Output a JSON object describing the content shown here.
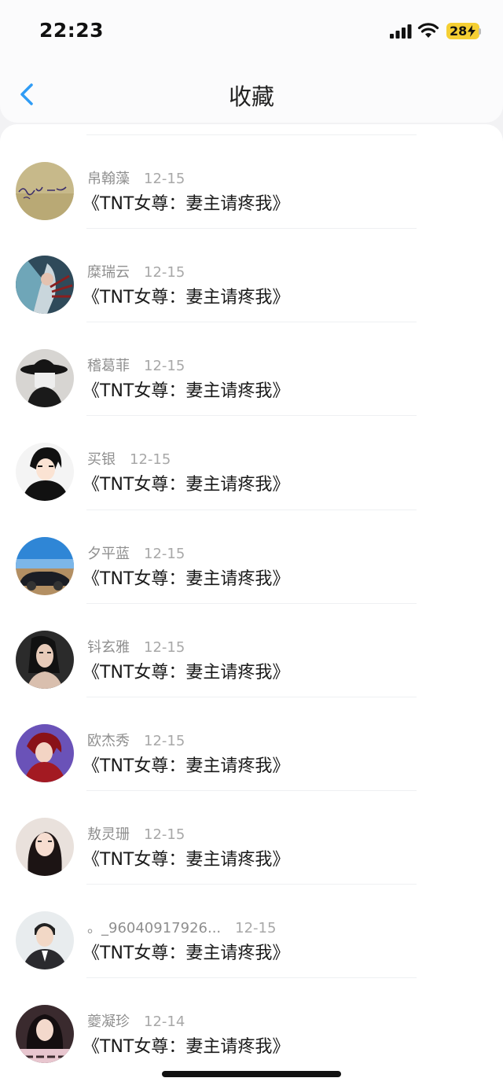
{
  "status_bar": {
    "time": "22:23",
    "battery": "28"
  },
  "header": {
    "title": "收藏",
    "back_icon": "chevron-left-icon",
    "accent_color": "#2f9cf5"
  },
  "items": [
    {
      "name": "帛翰藻",
      "date": "12-15",
      "title": "《TNT女尊：妻主请疼我》",
      "avatar": "handwriting"
    },
    {
      "name": "糜瑞云",
      "date": "12-15",
      "title": "《TNT女尊：妻主请疼我》",
      "avatar": "fantasy-warrior"
    },
    {
      "name": "稽葛菲",
      "date": "12-15",
      "title": "《TNT女尊：妻主请疼我》",
      "avatar": "hat-person"
    },
    {
      "name": "买银",
      "date": "12-15",
      "title": "《TNT女尊：妻主请疼我》",
      "avatar": "anime-boy"
    },
    {
      "name": "夕平蓝",
      "date": "12-15",
      "title": "《TNT女尊：妻主请疼我》",
      "avatar": "car-sky"
    },
    {
      "name": "钭玄雅",
      "date": "12-15",
      "title": "《TNT女尊：妻主请疼我》",
      "avatar": "woman-dark"
    },
    {
      "name": "欧杰秀",
      "date": "12-15",
      "title": "《TNT女尊：妻主请疼我》",
      "avatar": "anime-red"
    },
    {
      "name": "敖灵珊",
      "date": "12-15",
      "title": "《TNT女尊：妻主请疼我》",
      "avatar": "girl-portrait"
    },
    {
      "name": "。_96040917926...",
      "date": "12-15",
      "title": "《TNT女尊：妻主请疼我》",
      "avatar": "man-suit"
    },
    {
      "name": "夔凝珍",
      "date": "12-14",
      "title": "《TNT女尊：妻主请疼我》",
      "avatar": "girl-text"
    }
  ]
}
